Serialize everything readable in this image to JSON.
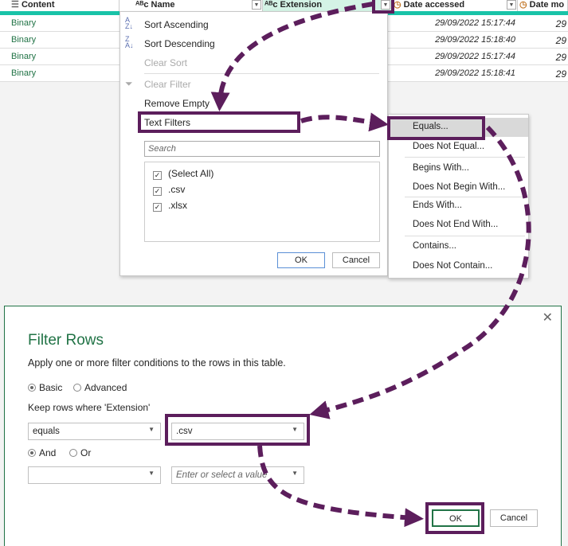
{
  "table": {
    "columns": [
      {
        "label": "Content",
        "icon": "list-icon"
      },
      {
        "label": "Name",
        "icon": "text-type-icon"
      },
      {
        "label": "Extension",
        "icon": "text-type-icon"
      },
      {
        "label": "Date accessed",
        "icon": "datetime-icon"
      },
      {
        "label": "Date mo",
        "icon": "datetime-icon"
      }
    ],
    "rows": [
      {
        "content": "Binary",
        "date": "29/09/2022 15:17:44",
        "next": "29"
      },
      {
        "content": "Binary",
        "date": "29/09/2022 15:18:40",
        "next": "29"
      },
      {
        "content": "Binary",
        "date": "29/09/2022 15:17:44",
        "next": "29"
      },
      {
        "content": "Binary",
        "date": "29/09/2022 15:18:41",
        "next": "29"
      }
    ]
  },
  "menu": {
    "sort_asc": "Sort Ascending",
    "sort_desc": "Sort Descending",
    "clear_sort": "Clear Sort",
    "clear_filter": "Clear Filter",
    "remove_empty": "Remove Empty",
    "text_filters": "Text Filters",
    "search_placeholder": "Search",
    "items": [
      "(Select All)",
      ".csv",
      ".xlsx"
    ],
    "ok": "OK",
    "cancel": "Cancel"
  },
  "submenu": [
    "Equals...",
    "Does Not Equal...",
    "Begins With...",
    "Does Not Begin With...",
    "Ends With...",
    "Does Not End With...",
    "Contains...",
    "Does Not Contain..."
  ],
  "dialog": {
    "title": "Filter Rows",
    "description": "Apply one or more filter conditions to the rows in this table.",
    "mode_basic": "Basic",
    "mode_advanced": "Advanced",
    "mode_selected": "Basic",
    "keep_label": "Keep rows where 'Extension'",
    "op1": "equals",
    "val1": ".csv",
    "and": "And",
    "or": "Or",
    "logic_selected": "And",
    "op2": "",
    "val2_placeholder": "Enter or select a value",
    "ok": "OK",
    "cancel": "Cancel"
  },
  "colors": {
    "accent": "#5c1e5c",
    "teal": "#19c3a8",
    "green": "#217346"
  }
}
